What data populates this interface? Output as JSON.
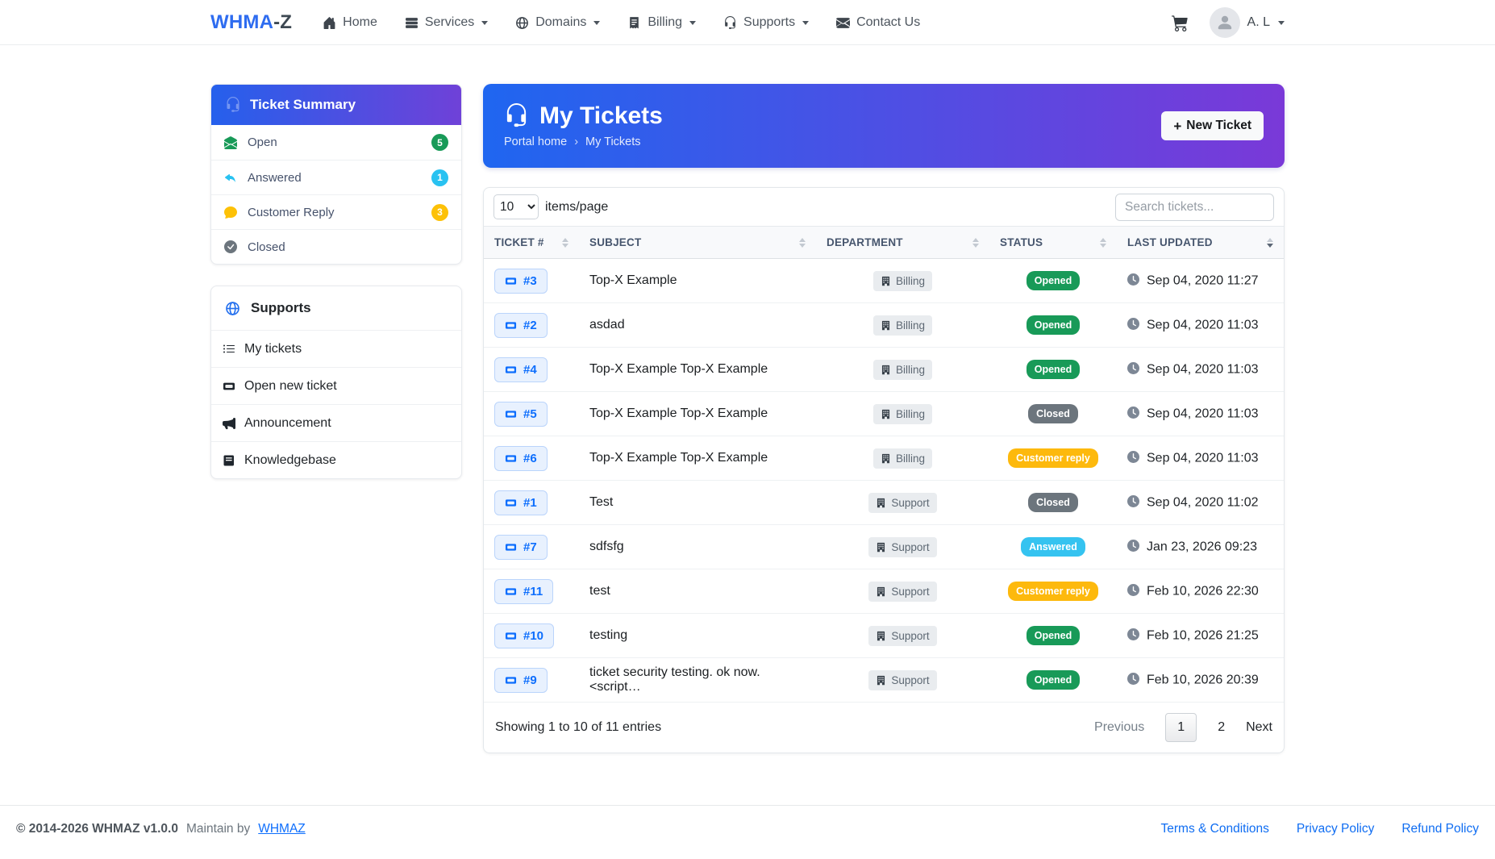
{
  "navbar": {
    "brand": {
      "primary": "WHMA",
      "suffix": "-Z"
    },
    "items": [
      {
        "label": "Home",
        "icon": "home-icon",
        "dropdown": false
      },
      {
        "label": "Services",
        "icon": "services-icon",
        "dropdown": true
      },
      {
        "label": "Domains",
        "icon": "globe-icon",
        "dropdown": true
      },
      {
        "label": "Billing",
        "icon": "billing-icon",
        "dropdown": true
      },
      {
        "label": "Supports",
        "icon": "headset-icon",
        "dropdown": true
      },
      {
        "label": "Contact Us",
        "icon": "envelope-icon",
        "dropdown": false
      }
    ],
    "user": {
      "name": "A. L"
    }
  },
  "sidebar": {
    "ticket_summary": {
      "title": "Ticket Summary",
      "items": [
        {
          "label": "Open",
          "icon": "envelope-open-icon",
          "count": "5",
          "color": "#189a58"
        },
        {
          "label": "Answered",
          "icon": "reply-icon",
          "count": "1",
          "color": "#29c2f1"
        },
        {
          "label": "Customer Reply",
          "icon": "chat-icon",
          "count": "3",
          "color": "#fdc107"
        },
        {
          "label": "Closed",
          "icon": "check-circle-icon",
          "count": "",
          "color": "#6c757d"
        }
      ]
    },
    "supports_menu": {
      "title": "Supports",
      "items": [
        {
          "label": "My tickets",
          "icon": "list-icon"
        },
        {
          "label": "Open new ticket",
          "icon": "ticket-icon"
        },
        {
          "label": "Announcement",
          "icon": "megaphone-icon"
        },
        {
          "label": "Knowledgebase",
          "icon": "book-icon"
        }
      ]
    }
  },
  "hero": {
    "title": "My Tickets",
    "breadcrumb": {
      "home": "Portal home",
      "separator": "›",
      "current": "My Tickets"
    },
    "plus": "+",
    "new_ticket_label": "New Ticket"
  },
  "controls": {
    "page_size": "10",
    "page_size_suffix": "items/page",
    "search_placeholder": "Search tickets..."
  },
  "table": {
    "columns": [
      "TICKET #",
      "SUBJECT",
      "DEPARTMENT",
      "STATUS",
      "LAST UPDATED"
    ],
    "rows": [
      {
        "id": "#3",
        "subject": "Top-X Example",
        "department": "Billing",
        "status": "Opened",
        "status_key": "opened",
        "updated": "Sep 04, 2020 11:27"
      },
      {
        "id": "#2",
        "subject": "asdad",
        "department": "Billing",
        "status": "Opened",
        "status_key": "opened",
        "updated": "Sep 04, 2020 11:03"
      },
      {
        "id": "#4",
        "subject": "Top-X Example Top-X Example",
        "department": "Billing",
        "status": "Opened",
        "status_key": "opened",
        "updated": "Sep 04, 2020 11:03"
      },
      {
        "id": "#5",
        "subject": "Top-X Example Top-X Example",
        "department": "Billing",
        "status": "Closed",
        "status_key": "closed",
        "updated": "Sep 04, 2020 11:03"
      },
      {
        "id": "#6",
        "subject": "Top-X Example Top-X Example",
        "department": "Billing",
        "status": "Customer reply",
        "status_key": "customer_reply",
        "updated": "Sep 04, 2020 11:03"
      },
      {
        "id": "#1",
        "subject": "Test",
        "department": "Support",
        "status": "Closed",
        "status_key": "closed",
        "updated": "Sep 04, 2020 11:02"
      },
      {
        "id": "#7",
        "subject": "sdfsfg",
        "department": "Support",
        "status": "Answered",
        "status_key": "answered",
        "updated": "Jan 23, 2026 09:23"
      },
      {
        "id": "#11",
        "subject": "test",
        "department": "Support",
        "status": "Customer reply",
        "status_key": "customer_reply",
        "updated": "Feb 10, 2026 22:30"
      },
      {
        "id": "#10",
        "subject": "testing",
        "department": "Support",
        "status": "Opened",
        "status_key": "opened",
        "updated": "Feb 10, 2026 21:25"
      },
      {
        "id": "#9",
        "subject": "ticket security testing. ok now. <script…",
        "department": "Support",
        "status": "Opened",
        "status_key": "opened",
        "updated": "Feb 10, 2026 20:39"
      }
    ]
  },
  "pagination": {
    "summary": "Showing 1 to 10 of 11 entries",
    "previous": "Previous",
    "pages": [
      "1",
      "2"
    ],
    "active_page": "1",
    "next": "Next"
  },
  "footer": {
    "copyright": "© 2014-2026 WHMAZ v1.0.0",
    "maintain_prefix": "Maintain by",
    "maintain_link": "WHMAZ",
    "links": [
      "Terms & Conditions",
      "Privacy Policy",
      "Refund Policy"
    ]
  },
  "colors": {
    "gradient_start": "#1f66f0",
    "gradient_end": "#7a39d8",
    "status": {
      "opened": "#189a58",
      "closed": "#6c757d",
      "customer_reply": "#fdb90d",
      "answered": "#35c3f0"
    }
  }
}
